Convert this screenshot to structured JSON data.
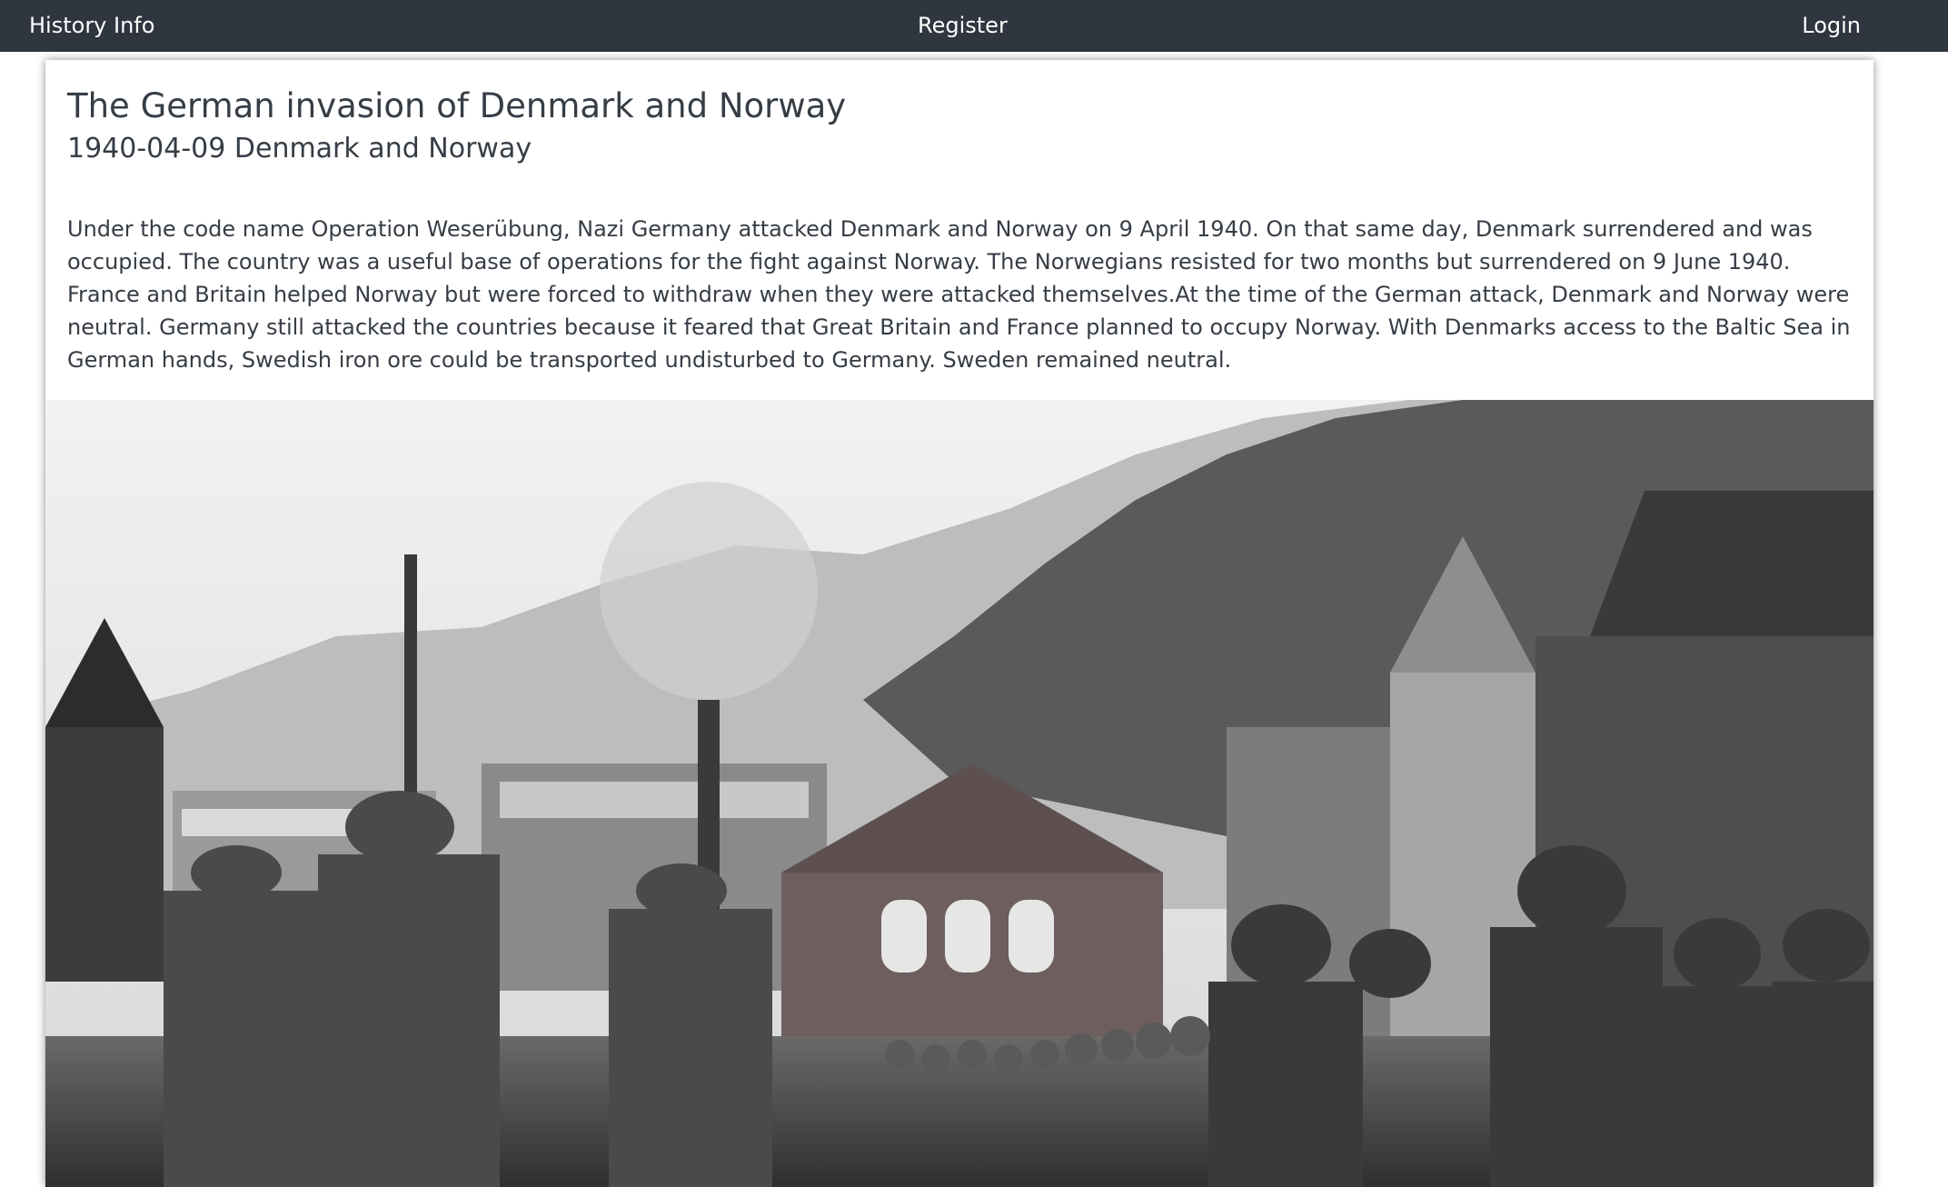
{
  "nav": {
    "brand": "History Info",
    "register": "Register",
    "login": "Login"
  },
  "article": {
    "title": "The German invasion of Denmark and Norway",
    "subtitle": "1940-04-09 Denmark and Norway",
    "body": "Under the code name Operation Weserübung, Nazi Germany attacked Denmark and Norway on 9 April 1940. On that same day, Denmark surrendered and was occupied. The country was a useful base of operations for the fight against Norway. The Norwegians resisted for two months but surrendered on 9 June 1940. France and Britain helped Norway but were forced to withdraw when they were attacked themselves.At the time of the German attack, Denmark and Norway were neutral. Germany still attacked the countries because it feared that Great Britain and France planned to occupy Norway. With Denmarks access to the Baltic Sea in German hands, Swedish iron ore could be transported undisturbed to Germany. Sweden remained neutral."
  },
  "colors": {
    "navbar_bg": "#2f3640",
    "nav_text": "#ffffff",
    "body_text": "#363d45"
  }
}
